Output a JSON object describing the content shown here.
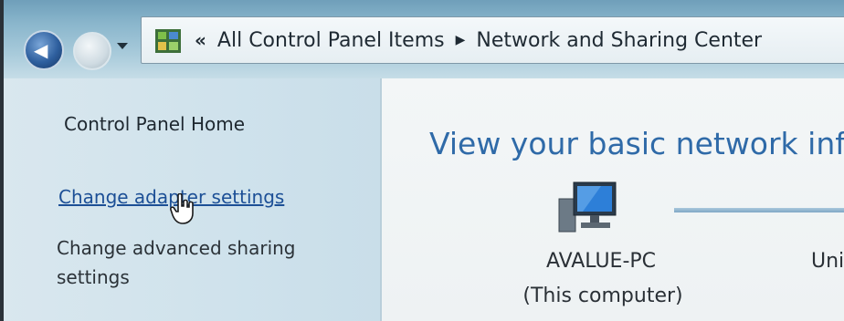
{
  "breadcrumb": {
    "overflow_glyph": "«",
    "items": [
      "All Control Panel Items",
      "Network and Sharing Center"
    ],
    "separator": "▶"
  },
  "sidebar": {
    "home": "Control Panel Home",
    "links": [
      "Change adapter settings",
      "Change advanced sharing settings"
    ]
  },
  "main": {
    "title": "View your basic network infor",
    "computer": {
      "name": "AVALUE-PC",
      "subtitle": "(This computer)"
    },
    "network_partial": "Uni"
  },
  "icons": {
    "back": "back-arrow-icon",
    "forward": "forward-arrow-icon",
    "history": "chevron-down-icon",
    "control_panel": "control-panel-icon",
    "computer": "computer-icon",
    "cursor": "hand-cursor-icon"
  },
  "colors": {
    "link": "#1c4f96",
    "title": "#2f6aa8",
    "sidebar_bg": "#d0e2eb"
  }
}
